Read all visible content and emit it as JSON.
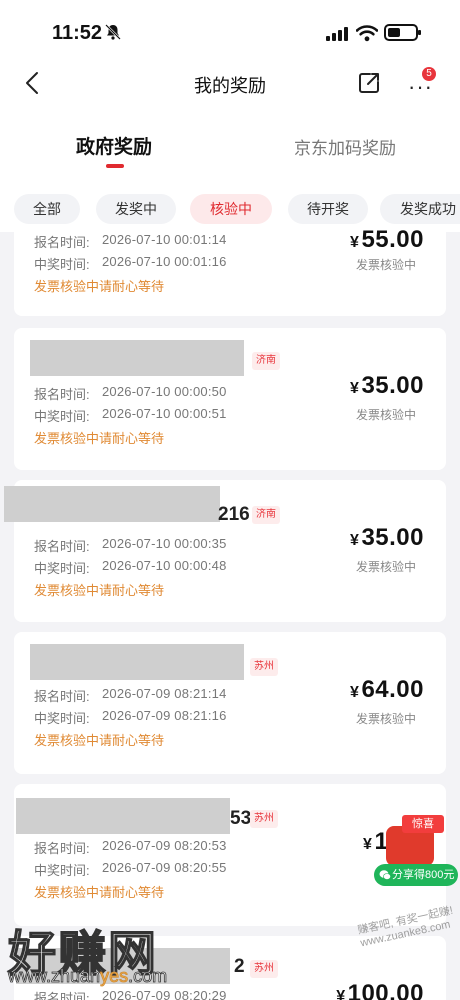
{
  "status_bar": {
    "time": "11:52"
  },
  "nav": {
    "title": "我的奖励",
    "more_badge": "5"
  },
  "main_tabs": [
    {
      "label": "政府奖励",
      "active": true
    },
    {
      "label": "京东加码奖励",
      "active": false
    }
  ],
  "filters": [
    {
      "label": "全部",
      "active": false
    },
    {
      "label": "发奖中",
      "active": false
    },
    {
      "label": "核验中",
      "active": true
    },
    {
      "label": "待开奖",
      "active": false
    },
    {
      "label": "发奖成功",
      "active": false
    }
  ],
  "labels": {
    "signup": "报名时间:",
    "win": "中奖时间:",
    "hint": "发票核验中请耐心等待",
    "yen": "¥"
  },
  "records": [
    {
      "city": "",
      "number_suffix": "",
      "signup_time": "2026-07-10 00:01:14",
      "win_time": "2026-07-10 00:01:16",
      "amount": "55.00",
      "status": "发票核验中"
    },
    {
      "city": "济南",
      "number_suffix": "",
      "signup_time": "2026-07-10 00:00:50",
      "win_time": "2026-07-10 00:00:51",
      "amount": "35.00",
      "status": "发票核验中"
    },
    {
      "city": "济南",
      "number_suffix": "216",
      "signup_time": "2026-07-10 00:00:35",
      "win_time": "2026-07-10 00:00:48",
      "amount": "35.00",
      "status": "发票核验中"
    },
    {
      "city": "苏州",
      "number_suffix": "",
      "signup_time": "2026-07-09 08:21:14",
      "win_time": "2026-07-09 08:21:16",
      "amount": "64.00",
      "status": "发票核验中"
    },
    {
      "city": "苏州",
      "number_suffix": "53",
      "signup_time": "2026-07-09 08:20:53",
      "win_time": "2026-07-09 08:20:55",
      "amount": "100",
      "status": "发"
    },
    {
      "city": "苏州",
      "number_suffix": "2",
      "signup_time": "2026-07-09 08:20:29",
      "win_time": "",
      "amount": "100.00",
      "status": ""
    }
  ],
  "promo": {
    "flag": "惊喜",
    "button": "分享得800元"
  },
  "watermark": {
    "logo": "好赚网",
    "site_pre": "www.zhuan",
    "site_y": "yes",
    "site_post": ".com",
    "slogan": "赚客吧, 有奖一起赚! www.zuanke8.com"
  }
}
